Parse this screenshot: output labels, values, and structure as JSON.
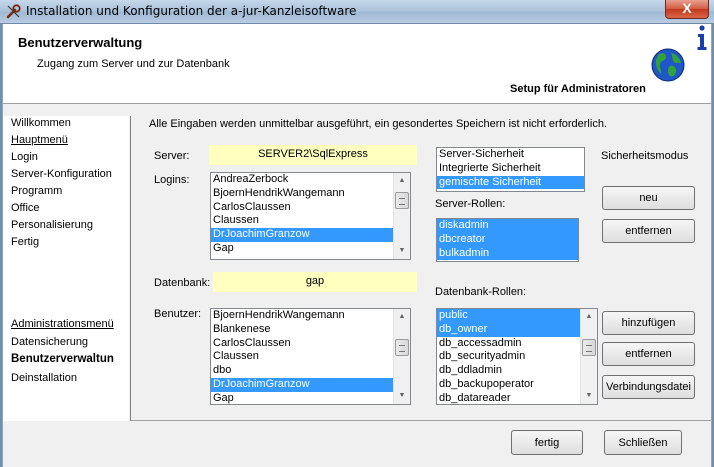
{
  "window": {
    "title": "Installation und Konfiguration der a-jur-Kanzleisoftware",
    "close_label": "X"
  },
  "header": {
    "title": "Benutzerverwaltung",
    "subtitle": "Zugang zum Server und zur Datenbank",
    "right_label": "Setup für Administratoren"
  },
  "nav": {
    "items": [
      {
        "label": "Willkommen"
      },
      {
        "label": "Hauptmenü"
      },
      {
        "label": "Login"
      },
      {
        "label": "Server-Konfiguration"
      },
      {
        "label": "Programm"
      },
      {
        "label": "Office"
      },
      {
        "label": "Personalisierung"
      },
      {
        "label": "Fertig"
      }
    ],
    "admin_items": [
      {
        "label": "Administrationsmenü"
      },
      {
        "label": "Datensicherung"
      },
      {
        "label": "Benutzerverwaltun"
      },
      {
        "label": "Deinstallation"
      }
    ]
  },
  "main": {
    "info_text": "Alle Eingaben werden unmittelbar ausgeführt, ein gesondertes Speichern ist nicht erforderlich.",
    "server_label": "Server:",
    "server_value": "SERVER2\\SqlExpress",
    "logins_label": "Logins:",
    "logins": [
      "AndreaZerbock",
      "BjoernHendrikWangemann",
      "CarlosClaussen",
      "Claussen",
      "DrJoachimGranzow",
      "Gap"
    ],
    "logins_selected": 4,
    "security_modes": [
      "Server-Sicherheit",
      "Integrierte Sicherheit",
      "gemischte Sicherheit"
    ],
    "security_selected": 2,
    "security_label": "Sicherheitsmodus",
    "server_roles_label": "Server-Rollen:",
    "server_roles": [
      "diskadmin",
      "dbcreator",
      "bulkadmin"
    ],
    "btn_new": "neu",
    "btn_remove1": "entfernen",
    "db_label": "Datenbank:",
    "db_value": "gap",
    "db_roles_label": "Datenbank-Rollen:",
    "users_label": "Benutzer:",
    "users": [
      "BjoernHendrikWangemann",
      "Blankenese",
      "CarlosClaussen",
      "Claussen",
      "dbo",
      "DrJoachimGranzow",
      "Gap"
    ],
    "users_selected": 5,
    "db_roles": [
      "public",
      "db_owner",
      "db_accessadmin",
      "db_securityadmin",
      "db_ddladmin",
      "db_backupoperator",
      "db_datareader"
    ],
    "db_roles_selected": [
      0,
      1
    ],
    "btn_add": "hinzufügen",
    "btn_remove2": "entfernen",
    "btn_connfile": "Verbindungsdatei"
  },
  "footer": {
    "btn_finish": "fertig",
    "btn_close": "Schließen"
  }
}
